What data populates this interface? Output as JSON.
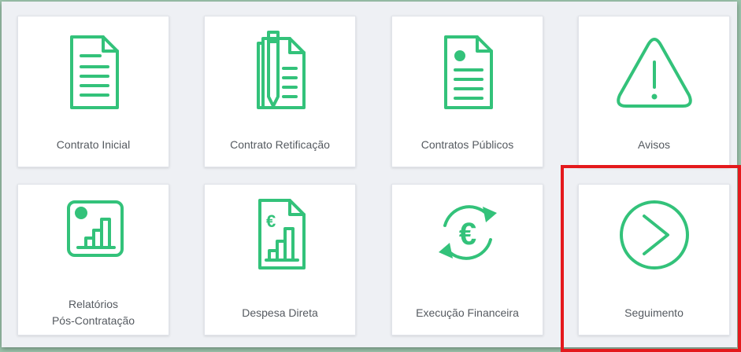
{
  "tiles": [
    {
      "label": "Contrato Inicial",
      "icon": "document-icon"
    },
    {
      "label": "Contrato Retificação",
      "icon": "document-pen-icon"
    },
    {
      "label": "Contratos Públicos",
      "icon": "document-public-icon"
    },
    {
      "label": "Avisos",
      "icon": "warning-icon"
    },
    {
      "label_line1": "Relatórios",
      "label_line2": "Pós-Contratação",
      "icon": "report-chart-icon"
    },
    {
      "label": "Despesa Direta",
      "icon": "euro-document-chart-icon"
    },
    {
      "label": "Execução Financeira",
      "icon": "euro-cycle-icon"
    },
    {
      "label": "Seguimento",
      "icon": "chevron-circle-icon"
    }
  ],
  "colors": {
    "accent": "#33c27a",
    "highlight": "#e4191c"
  }
}
